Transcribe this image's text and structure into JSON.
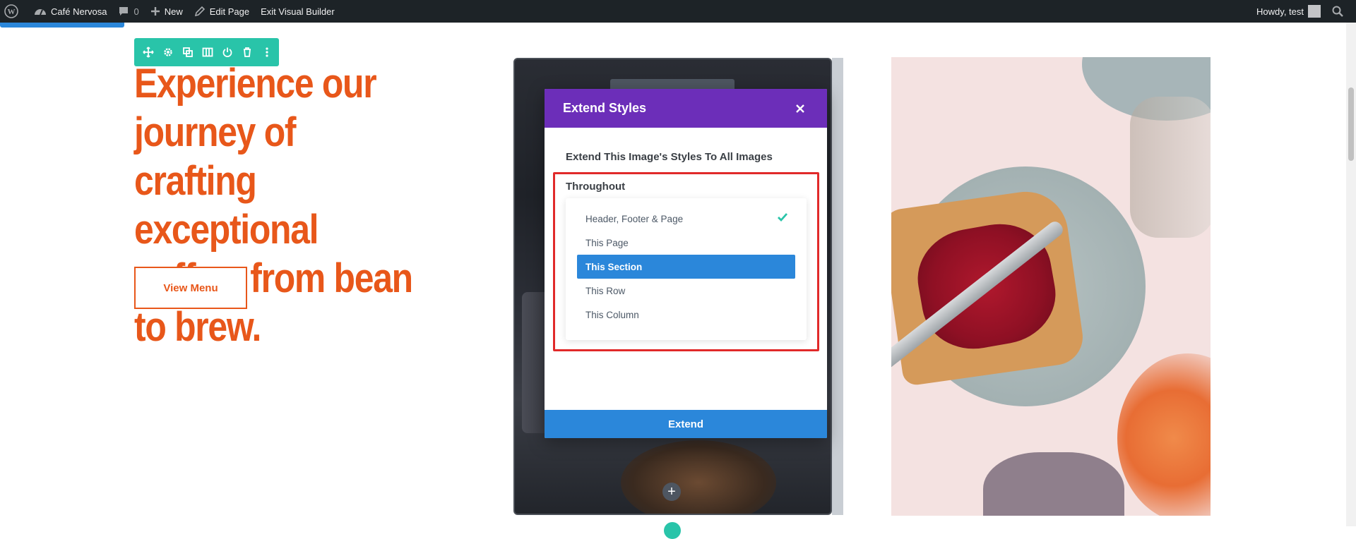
{
  "admin_bar": {
    "site_name": "Café Nervosa",
    "comments_count": "0",
    "new_label": "New",
    "edit_page_label": "Edit Page",
    "exit_builder_label": "Exit Visual Builder",
    "howdy_label": "Howdy, test"
  },
  "hero": {
    "heading": "Experience our journey of crafting exceptional coffee, from bean to brew.",
    "button_label": "View Menu"
  },
  "dialog": {
    "title": "Extend Styles",
    "subtitle": "Extend This Image's Styles To All Images",
    "throughout_label": "Throughout",
    "options": [
      {
        "label": "Header, Footer & Page",
        "checked": true,
        "selected": false
      },
      {
        "label": "This Page",
        "checked": false,
        "selected": false
      },
      {
        "label": "This Section",
        "checked": false,
        "selected": true
      },
      {
        "label": "This Row",
        "checked": false,
        "selected": false
      },
      {
        "label": "This Column",
        "checked": false,
        "selected": false
      }
    ],
    "extend_label": "Extend"
  },
  "colors": {
    "brand_orange": "#e8571a",
    "dialog_purple": "#6c2eb9",
    "accent_blue": "#2b87da",
    "toolbar_teal": "#29c4a9",
    "highlight_red": "#e12a2a",
    "check_green": "#29c4a9"
  }
}
